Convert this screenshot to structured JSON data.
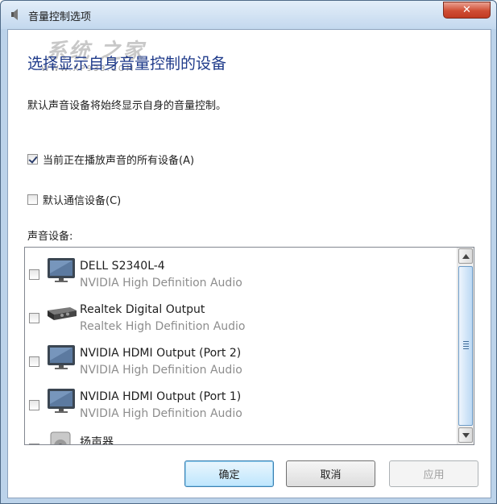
{
  "window": {
    "title": "音量控制选项",
    "close_symbol": "✕"
  },
  "watermark": {
    "text": "系统 之家",
    "url": "WWW.XP933.COM"
  },
  "heading": "选择显示自身音量控制的设备",
  "description": "默认声音设备将始终显示自身的音量控制。",
  "options": [
    {
      "label": "当前正在播放声音的所有设备(A)",
      "checked": true
    },
    {
      "label": "默认通信设备(C)",
      "checked": false
    }
  ],
  "devices_title": "声音设备:",
  "devices": [
    {
      "name": "DELL S2340L-4",
      "sub": "NVIDIA High Definition Audio",
      "icon": "monitor-icon"
    },
    {
      "name": "Realtek Digital Output",
      "sub": "Realtek High Definition Audio",
      "icon": "digital-output-icon"
    },
    {
      "name": "NVIDIA HDMI Output (Port 2)",
      "sub": "NVIDIA High Definition Audio",
      "icon": "monitor-icon"
    },
    {
      "name": "NVIDIA HDMI Output (Port 1)",
      "sub": "NVIDIA High Definition Audio",
      "icon": "monitor-icon"
    },
    {
      "name": "扬声器",
      "sub": "",
      "icon": "speaker-icon"
    }
  ],
  "buttons": {
    "ok": "确定",
    "cancel": "取消",
    "apply": "应用"
  },
  "colors": {
    "heading": "#1e3a8a",
    "secondary_text": "#8d8d8d",
    "close_button": "#c13a22"
  }
}
